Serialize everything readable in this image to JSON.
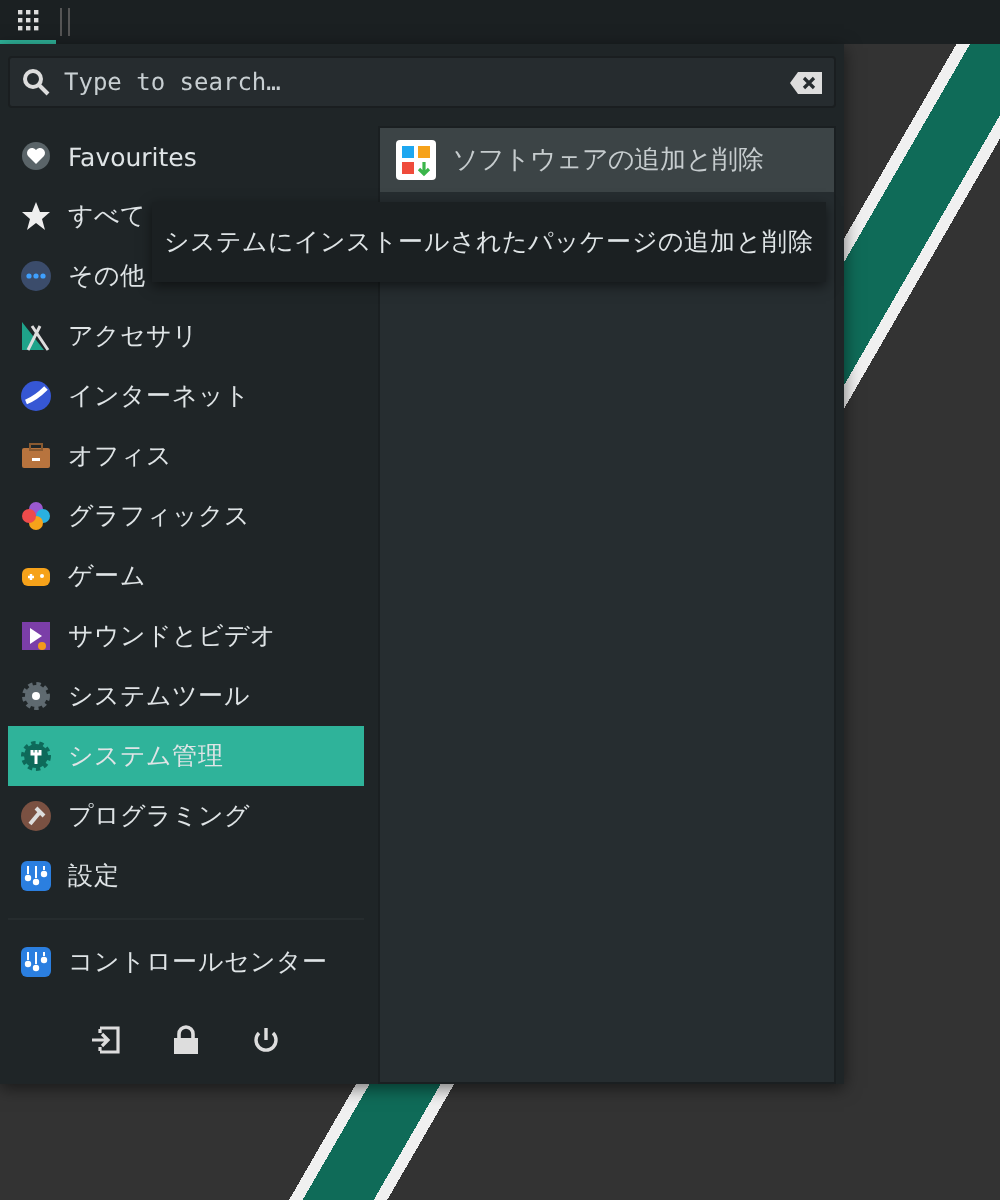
{
  "panel": {
    "launcher_active": true
  },
  "search": {
    "placeholder": "Type to search…"
  },
  "categories": [
    {
      "label": "Favourites",
      "selected": false
    },
    {
      "label": "すべて",
      "selected": false
    },
    {
      "label": "その他",
      "selected": false
    },
    {
      "label": "アクセサリ",
      "selected": false
    },
    {
      "label": "インターネット",
      "selected": false
    },
    {
      "label": "オフィス",
      "selected": false
    },
    {
      "label": "グラフィックス",
      "selected": false
    },
    {
      "label": "ゲーム",
      "selected": false
    },
    {
      "label": "サウンドとビデオ",
      "selected": false
    },
    {
      "label": "システムツール",
      "selected": false
    },
    {
      "label": "システム管理",
      "selected": true
    },
    {
      "label": "プログラミング",
      "selected": false
    },
    {
      "label": "設定",
      "selected": false
    }
  ],
  "pinned": [
    {
      "label": "コントロールセンター"
    }
  ],
  "apps": [
    {
      "label": "ソフトウェアの追加と削除",
      "selected": true
    }
  ],
  "tooltip": "システムにインストールされたパッケージの追加と削除",
  "session_buttons": [
    {
      "kind": "logout"
    },
    {
      "kind": "lock"
    },
    {
      "kind": "power"
    }
  ]
}
